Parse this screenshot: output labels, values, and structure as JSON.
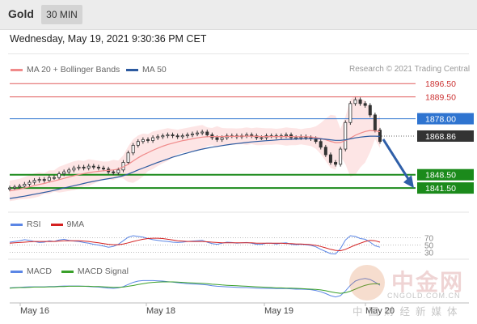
{
  "header": {
    "title": "Gold",
    "timeframe": "30 MIN"
  },
  "datetime": "Wednesday, May 19, 2021 9:30:36 PM CET",
  "legend": {
    "ma20_label": "MA 20 + Bollinger Bands",
    "ma50_label": "MA 50",
    "credit": "Research © 2021 Trading Central",
    "rsi_label": "RSI",
    "rsi_ma_label": "9MA",
    "macd_label": "MACD",
    "macd_signal_label": "MACD Signal"
  },
  "colors": {
    "ma20": "#f08a8a",
    "ma50": "#2c5aa0",
    "bands_fill": "#fde0e0",
    "resistance": "#e05a5a",
    "pivot": "#2f74d0",
    "support": "#1b8a1b",
    "price_tag": "#333333",
    "arrow": "#2f5fa8",
    "rsi": "#5b86e5",
    "rsi_ma": "#d42020",
    "macd": "#5b86e5",
    "macd_signal": "#3aa02a"
  },
  "levels": [
    {
      "label": "1896.50",
      "value": 1896.5,
      "kind": "resistance"
    },
    {
      "label": "1889.50",
      "value": 1889.5,
      "kind": "resistance"
    },
    {
      "label": "1878.00",
      "value": 1878.0,
      "kind": "pivot"
    },
    {
      "label": "1868.86",
      "value": 1868.86,
      "kind": "last"
    },
    {
      "label": "1848.50",
      "value": 1848.5,
      "kind": "support"
    },
    {
      "label": "1841.50",
      "value": 1841.5,
      "kind": "support"
    }
  ],
  "rsi_levels": [
    "70",
    "50",
    "30"
  ],
  "x_labels": [
    "May 16",
    "May 18",
    "May 19",
    "May 20"
  ],
  "watermark": {
    "cn": "中金网",
    "url": "CNGOLD.COM.CN",
    "sub": "中国财经新媒体"
  },
  "chart_data": {
    "type": "candlestick",
    "symbol": "Gold",
    "interval": "30 MIN",
    "price_range": [
      1836,
      1900
    ],
    "rsi_range": [
      0,
      100
    ],
    "close": [
      1841.5,
      1842,
      1842.5,
      1843.5,
      1844.5,
      1845.5,
      1846,
      1845.5,
      1847,
      1847,
      1849,
      1850,
      1851,
      1852,
      1852.5,
      1852,
      1853,
      1852.5,
      1852,
      1851.5,
      1850,
      1849.5,
      1851,
      1855,
      1860,
      1864,
      1866,
      1867,
      1866.5,
      1868,
      1868.5,
      1869,
      1869.5,
      1869,
      1868.5,
      1869,
      1869.5,
      1870,
      1870.5,
      1871,
      1869.5,
      1868,
      1867,
      1868,
      1869,
      1869,
      1868.5,
      1869,
      1869.5,
      1869,
      1868,
      1868,
      1869,
      1869,
      1868.5,
      1869,
      1869.5,
      1868,
      1868,
      1868.5,
      1868,
      1867.5,
      1866,
      1863,
      1859,
      1855,
      1854,
      1862,
      1876,
      1886,
      1888,
      1886,
      1885,
      1880,
      1872,
      1866
    ],
    "ma20": [
      1840,
      1840.4,
      1840.9,
      1841.5,
      1842.1,
      1842.8,
      1843.4,
      1843.9,
      1844.6,
      1845.2,
      1845.9,
      1846.6,
      1847.3,
      1848,
      1848.6,
      1849.1,
      1849.6,
      1850,
      1850.3,
      1850.6,
      1850.8,
      1851,
      1851.5,
      1852.6,
      1854,
      1855.7,
      1857.4,
      1858.9,
      1860.1,
      1861.4,
      1862.5,
      1863.5,
      1864.4,
      1865.1,
      1865.8,
      1866.4,
      1866.9,
      1867.4,
      1867.9,
      1868.3,
      1868.5,
      1868.6,
      1868.6,
      1868.6,
      1868.7,
      1868.7,
      1868.7,
      1868.8,
      1868.8,
      1868.8,
      1868.7,
      1868.6,
      1868.6,
      1868.6,
      1868.6,
      1868.6,
      1868.6,
      1868.6,
      1868.5,
      1868.5,
      1868.5,
      1868.4,
      1868.1,
      1867.6,
      1866.9,
      1866.1,
      1865.4,
      1865.5,
      1866.5,
      1867.8,
      1869.3,
      1870.4,
      1871.3,
      1871.8,
      1871.6,
      1871.2
    ],
    "ma50": [
      1836,
      1836.4,
      1836.8,
      1837.2,
      1837.7,
      1838.2,
      1838.7,
      1839.2,
      1839.7,
      1840.3,
      1840.9,
      1841.5,
      1842.1,
      1842.7,
      1843.3,
      1843.9,
      1844.5,
      1845,
      1845.5,
      1846,
      1846.4,
      1846.8,
      1847.3,
      1848,
      1848.9,
      1849.9,
      1851,
      1852,
      1853,
      1854,
      1855,
      1855.9,
      1856.8,
      1857.7,
      1858.5,
      1859.3,
      1860,
      1860.7,
      1861.4,
      1862,
      1862.5,
      1863,
      1863.4,
      1863.8,
      1864.2,
      1864.6,
      1864.9,
      1865.2,
      1865.5,
      1865.8,
      1866,
      1866.2,
      1866.4,
      1866.6,
      1866.8,
      1867,
      1867.1,
      1867.2,
      1867.3,
      1867.4,
      1867.5,
      1867.5,
      1867.5,
      1867.4,
      1867.2,
      1866.9,
      1866.6,
      1866.6,
      1866.9,
      1867.4,
      1867.9,
      1868.3,
      1868.6,
      1868.8,
      1868.8,
      1868.7
    ],
    "rsi": [
      58,
      60,
      62,
      65,
      63,
      60,
      57,
      58,
      62,
      60,
      64,
      66,
      63,
      61,
      60,
      57,
      55,
      52,
      50,
      47,
      44,
      46,
      52,
      62,
      72,
      76,
      74,
      72,
      68,
      65,
      63,
      61,
      60,
      58,
      57,
      58,
      60,
      61,
      62,
      63,
      58,
      54,
      52,
      55,
      58,
      57,
      55,
      56,
      57,
      55,
      52,
      52,
      55,
      55,
      53,
      55,
      56,
      52,
      51,
      52,
      51,
      49,
      45,
      38,
      32,
      26,
      25,
      40,
      64,
      76,
      74,
      68,
      66,
      58,
      48,
      44
    ],
    "rsi_ma": [
      55,
      56,
      57,
      58,
      59,
      60,
      60,
      60,
      60,
      60,
      61,
      62,
      62,
      62,
      62,
      61,
      60,
      58,
      56,
      54,
      52,
      51,
      51,
      53,
      56,
      60,
      63,
      66,
      68,
      69,
      69,
      68,
      66,
      64,
      62,
      61,
      60,
      60,
      60,
      60,
      59,
      58,
      57,
      56,
      56,
      56,
      56,
      56,
      56,
      56,
      55,
      55,
      55,
      55,
      55,
      55,
      54,
      54,
      53,
      53,
      52,
      51,
      49,
      46,
      42,
      38,
      35,
      34,
      38,
      44,
      50,
      55,
      60,
      63,
      62,
      58
    ],
    "macd": [
      0.2,
      0.3,
      0.4,
      0.5,
      0.6,
      0.6,
      0.6,
      0.6,
      0.7,
      0.7,
      0.8,
      0.9,
      0.9,
      0.9,
      0.9,
      0.8,
      0.7,
      0.6,
      0.5,
      0.3,
      0.1,
      0,
      0.2,
      0.7,
      1.5,
      2.3,
      2.8,
      3,
      3,
      3,
      2.9,
      2.8,
      2.6,
      2.4,
      2.2,
      2,
      1.8,
      1.7,
      1.6,
      1.5,
      1.3,
      1,
      0.8,
      0.7,
      0.6,
      0.5,
      0.4,
      0.3,
      0.3,
      0.2,
      0.1,
      0,
      0,
      0,
      -0.1,
      -0.1,
      -0.1,
      -0.2,
      -0.3,
      -0.3,
      -0.4,
      -0.5,
      -0.8,
      -1.3,
      -2,
      -2.8,
      -3.3,
      -2.8,
      -1,
      1.2,
      2.8,
      3.5,
      3.8,
      3.4,
      2.4,
      1.2
    ],
    "macd_signal": [
      0.1,
      0.2,
      0.3,
      0.3,
      0.4,
      0.5,
      0.5,
      0.5,
      0.6,
      0.6,
      0.7,
      0.7,
      0.8,
      0.8,
      0.8,
      0.8,
      0.8,
      0.7,
      0.7,
      0.6,
      0.5,
      0.4,
      0.4,
      0.5,
      0.8,
      1.1,
      1.5,
      1.8,
      2.1,
      2.3,
      2.4,
      2.5,
      2.5,
      2.5,
      2.4,
      2.3,
      2.2,
      2.1,
      2,
      1.9,
      1.8,
      1.6,
      1.5,
      1.3,
      1.2,
      1.1,
      1,
      0.9,
      0.8,
      0.7,
      0.6,
      0.5,
      0.4,
      0.3,
      0.2,
      0.2,
      0.1,
      0.1,
      0,
      -0.1,
      -0.2,
      -0.3,
      -0.4,
      -0.6,
      -0.9,
      -1.3,
      -1.7,
      -1.9,
      -1.7,
      -1.1,
      -0.3,
      0.5,
      1.2,
      1.6,
      1.8,
      1.7
    ],
    "forecast_arrow": {
      "from": 1868.86,
      "to": 1841.5
    }
  }
}
